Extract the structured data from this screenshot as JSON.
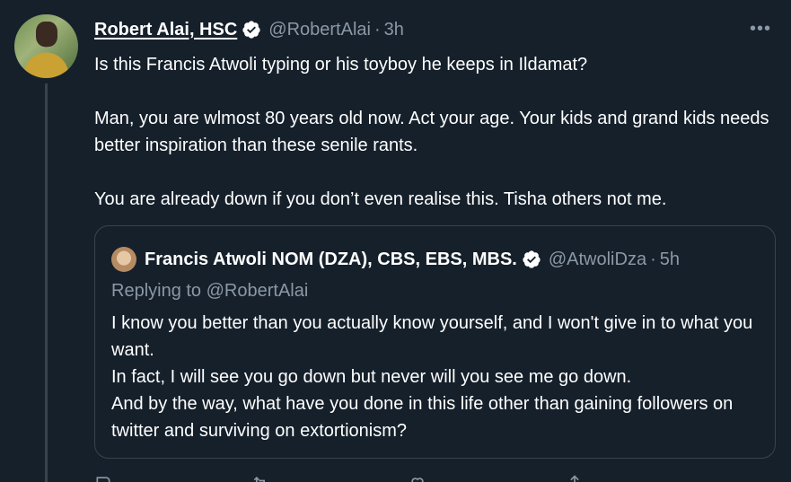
{
  "author": {
    "name": "Robert Alai, HSC",
    "handle": "@RobertAlai",
    "separator": "·",
    "time": "3h"
  },
  "tweet": {
    "paragraphs": [
      "Is this Francis Atwoli typing or his toyboy he keeps in Ildamat?",
      "Man, you are wlmost 80 years old now. Act your age. Your kids and grand kids needs better inspiration than these senile rants.",
      "You are already down if you don’t even realise this. Tisha others not me."
    ]
  },
  "more_label": "•••",
  "quoted": {
    "name": "Francis Atwoli NOM (DZA), CBS, EBS, MBS.",
    "handle": "@AtwoliDza",
    "separator": "·",
    "time": "5h",
    "replying_to": "Replying to @RobertAlai",
    "lines": [
      "I know you better than you actually know yourself, and I won't give in to what you want.",
      "In fact, I will see you go down but never will you see me go down.",
      "And by the way, what have you done in this life other than gaining followers on twitter and surviving on extortionism?"
    ]
  },
  "colors": {
    "background": "#15202b",
    "secondary_text": "#8b98a5",
    "border": "#38444d",
    "verified": "#ffffff"
  },
  "icons": [
    "verified-badge-icon",
    "more-options-icon",
    "reply-icon",
    "retweet-icon",
    "like-icon",
    "share-icon"
  ]
}
